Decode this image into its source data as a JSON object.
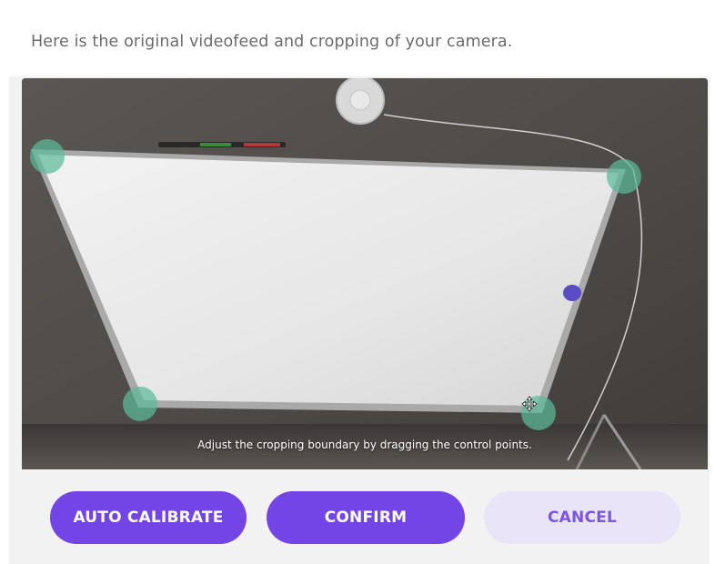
{
  "intro_text": "Here is the original videofeed and cropping of your camera.",
  "video": {
    "caption": "Adjust the cropping boundary by dragging the control points."
  },
  "buttons": {
    "auto_calibrate": "AUTO CALIBRATE",
    "confirm": "CONFIRM",
    "cancel": "CANCEL"
  },
  "colors": {
    "primary": "#7445e6",
    "secondary_bg": "#e9e4f7",
    "secondary_text": "#7a55e0",
    "handle": "#5cba9a"
  },
  "icons": {
    "active_handle": "move-icon"
  }
}
